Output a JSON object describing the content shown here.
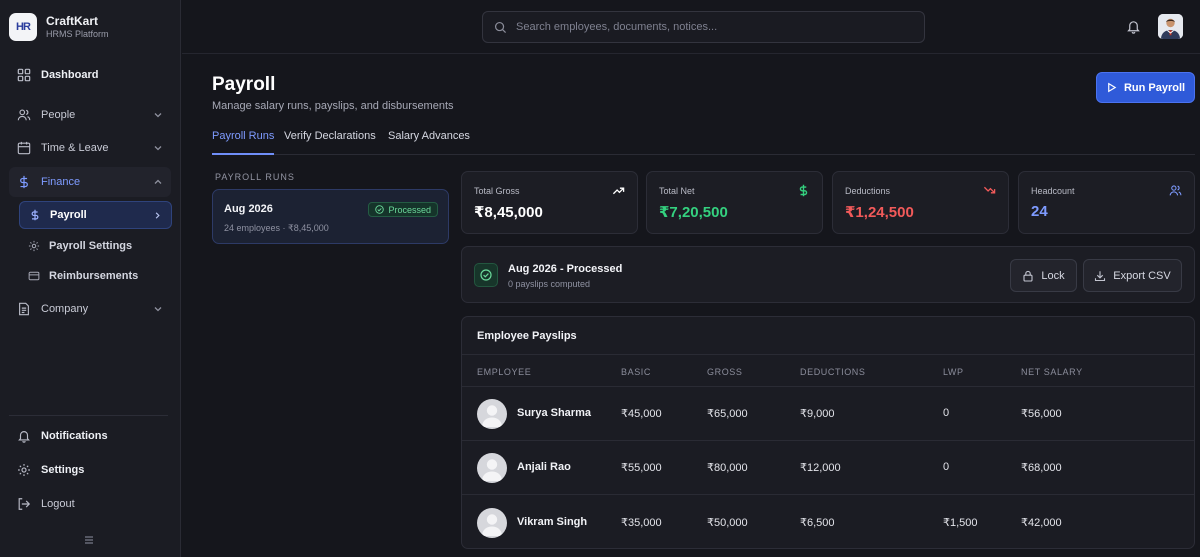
{
  "brand": {
    "name": "CraftKart",
    "subtitle": "HRMS Platform",
    "logo_text": "HR"
  },
  "sidebar": {
    "dashboard": "Dashboard",
    "people": "People",
    "time_leave": "Time & Leave",
    "finance": "Finance",
    "finance_sub": {
      "payroll": "Payroll",
      "payroll_settings": "Payroll Settings",
      "reimbursements": "Reimbursements"
    },
    "company": "Company",
    "notifications": "Notifications",
    "settings": "Settings",
    "logout": "Logout"
  },
  "search": {
    "placeholder": "Search employees, documents, notices..."
  },
  "header": {
    "title": "Payroll",
    "subtitle": "Manage salary runs, payslips, and disbursements",
    "run_button": "Run Payroll"
  },
  "tabs": [
    "Payroll Runs",
    "Verify Declarations",
    "Salary Advances"
  ],
  "runs": {
    "label": "PAYROLL RUNS",
    "items": [
      {
        "name": "Aug 2026",
        "meta": "24 employees · ₹8,45,000",
        "status": "Processed"
      }
    ]
  },
  "stats": [
    {
      "label": "Total Gross",
      "value": "₹8,45,000",
      "color": "#ffffff",
      "icon": "trending-up-icon"
    },
    {
      "label": "Total Net",
      "value": "₹7,20,500",
      "color": "#34d17f",
      "icon": "dollar-icon"
    },
    {
      "label": "Deductions",
      "value": "₹1,24,500",
      "color": "#f25a5a",
      "icon": "trending-down-icon"
    },
    {
      "label": "Headcount",
      "value": "24",
      "color": "#7e9bff",
      "icon": "users-icon"
    }
  ],
  "status": {
    "title": "Aug 2026 - Processed",
    "subtitle": "0 payslips computed",
    "lock": "Lock",
    "export": "Export CSV"
  },
  "table": {
    "title": "Employee Payslips",
    "columns": [
      "EMPLOYEE",
      "BASIC",
      "GROSS",
      "DEDUCTIONS",
      "LWP",
      "NET SALARY"
    ],
    "rows": [
      {
        "name": "Surya Sharma",
        "basic": "₹45,000",
        "gross": "₹65,000",
        "deductions": "₹9,000",
        "lwp": "0",
        "net": "₹56,000"
      },
      {
        "name": "Anjali Rao",
        "basic": "₹55,000",
        "gross": "₹80,000",
        "deductions": "₹12,000",
        "lwp": "0",
        "net": "₹68,000"
      },
      {
        "name": "Vikram Singh",
        "basic": "₹35,000",
        "gross": "₹50,000",
        "deductions": "₹6,500",
        "lwp": "₹1,500",
        "net": "₹42,000"
      }
    ]
  }
}
